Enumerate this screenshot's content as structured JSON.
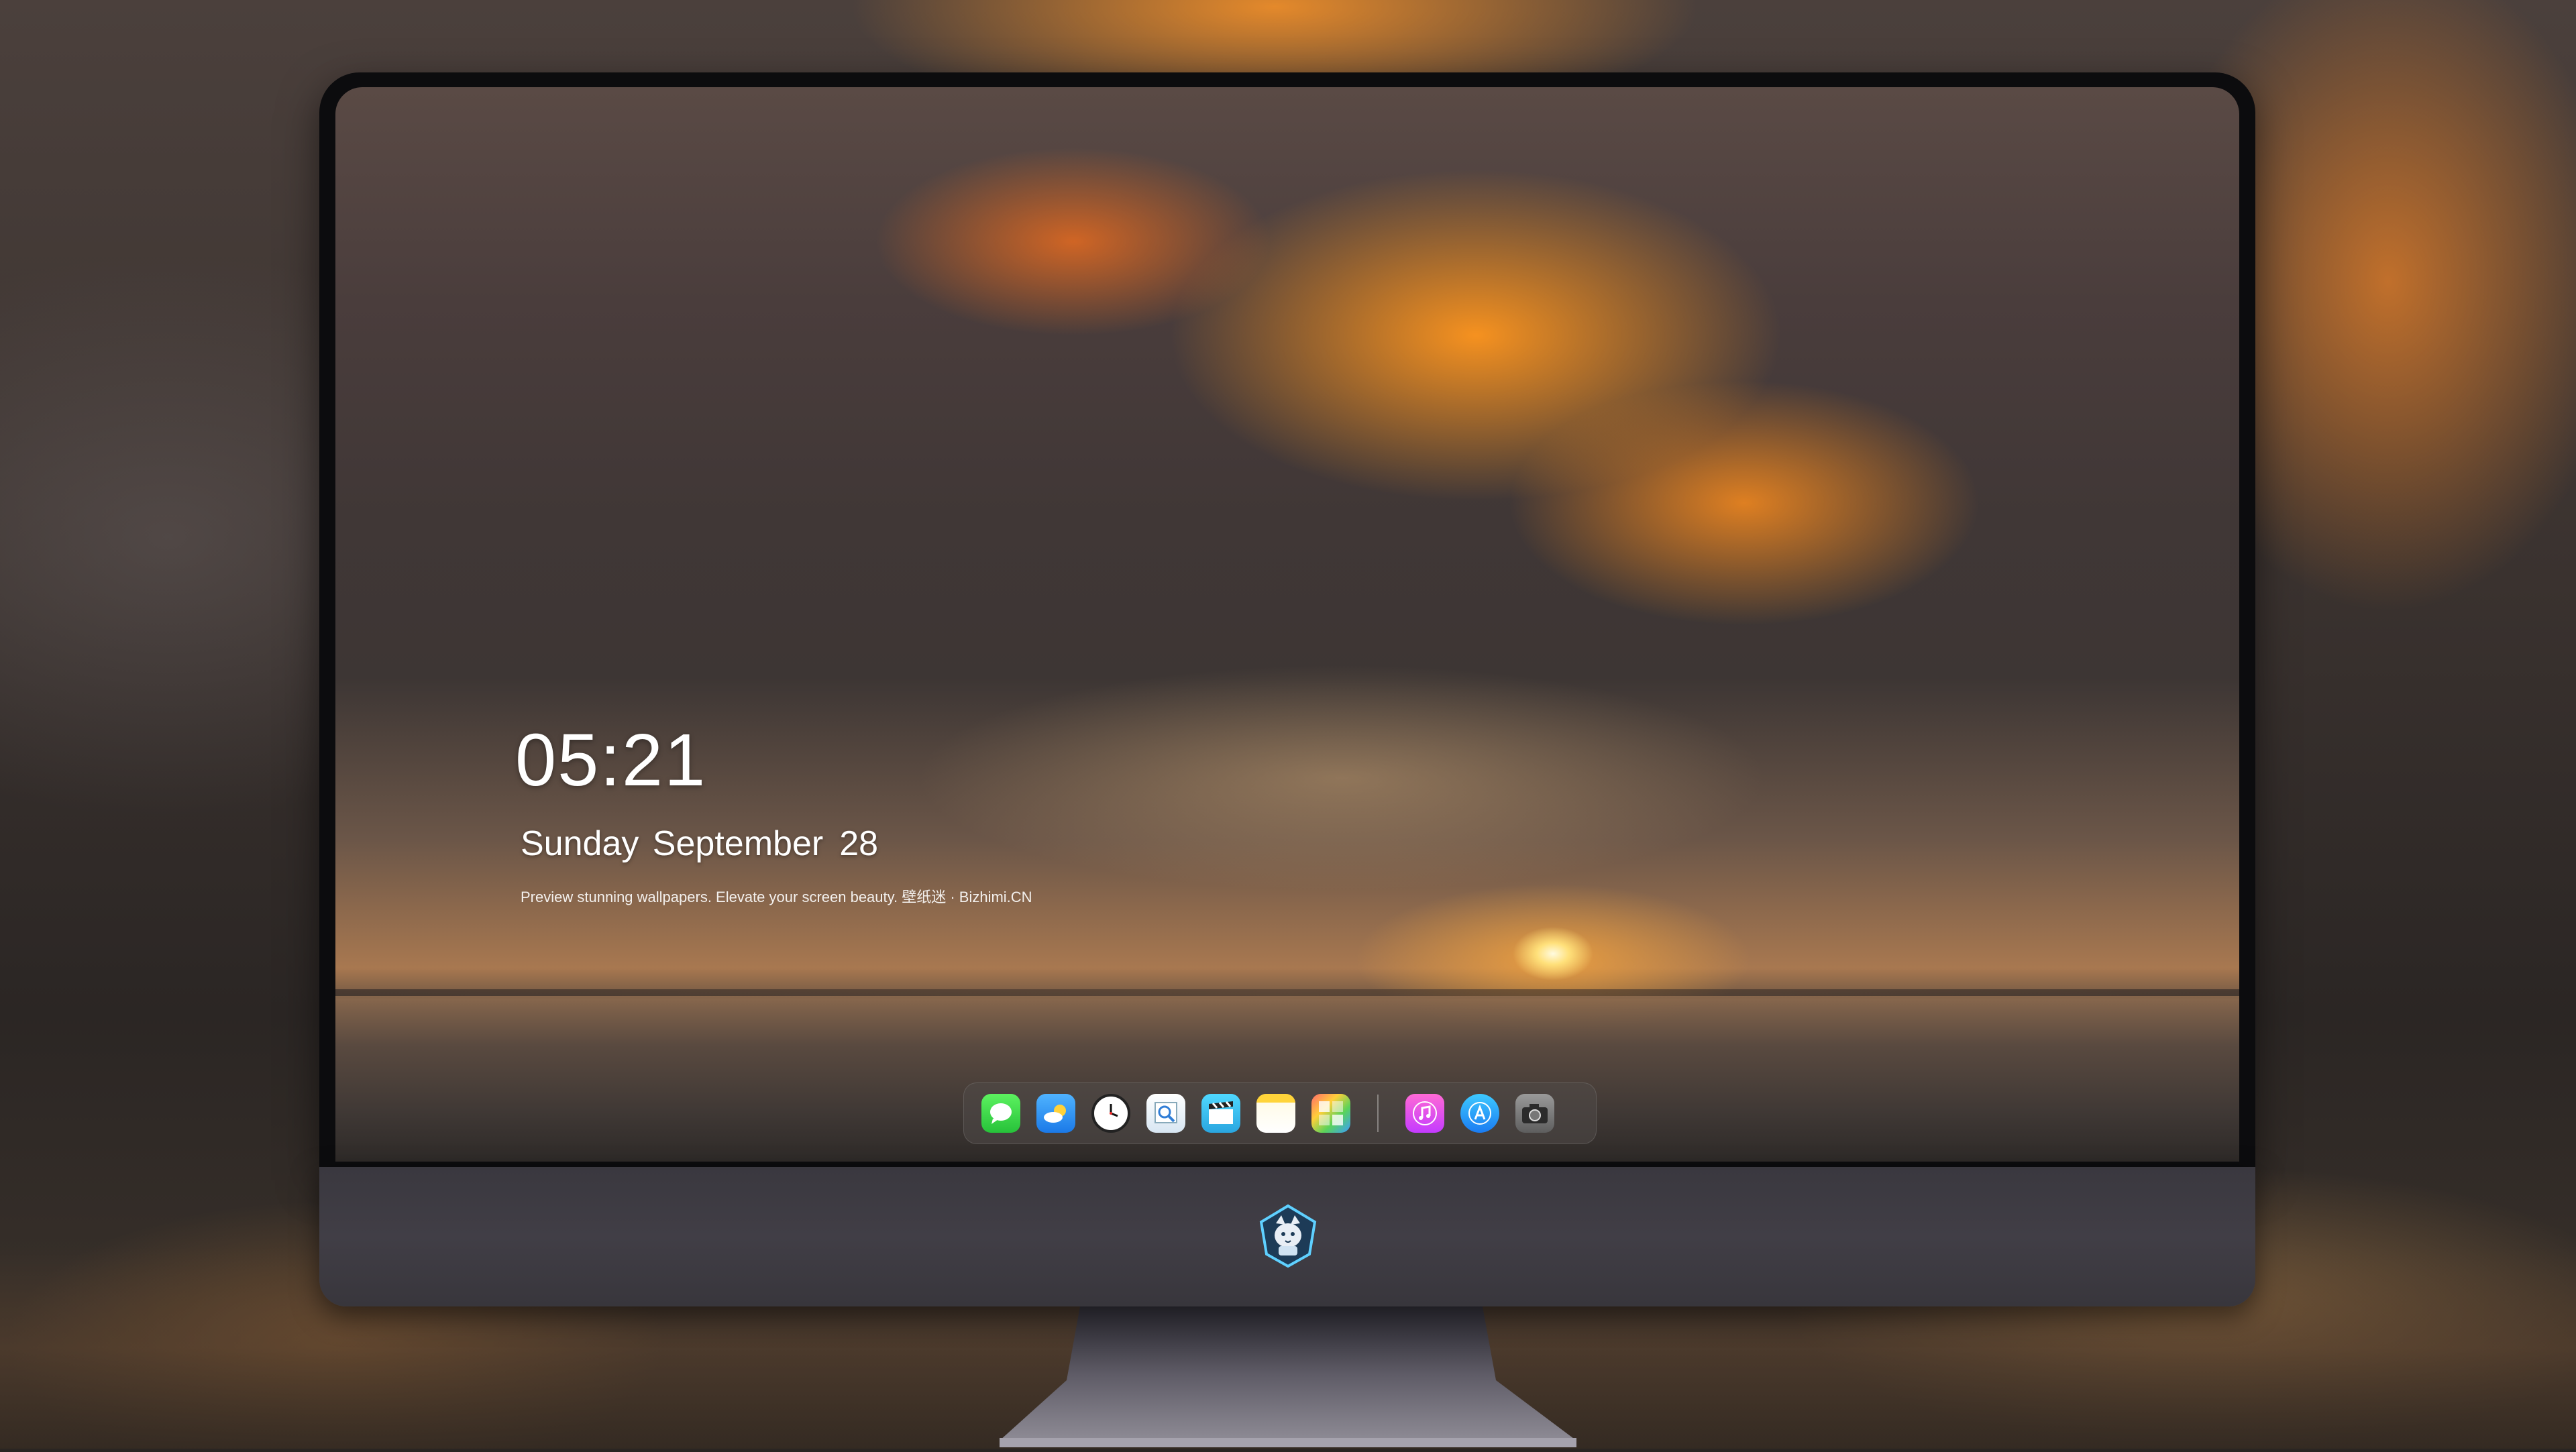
{
  "lockscreen": {
    "time": "05:21",
    "weekday_month": "Sunday September",
    "day": "28",
    "tagline": "Preview stunning wallpapers. Elevate your screen beauty. 壁纸迷 · Bizhimi.CN"
  },
  "dock": {
    "apps": [
      {
        "name": "messages-icon",
        "glyph": "💬"
      },
      {
        "name": "weather-icon",
        "glyph": "☁"
      },
      {
        "name": "clock-icon",
        "glyph": "🕓"
      },
      {
        "name": "preview-icon",
        "glyph": "🔍"
      },
      {
        "name": "clips-icon",
        "glyph": "🎬"
      },
      {
        "name": "notes-icon",
        "glyph": ""
      },
      {
        "name": "collage-icon",
        "glyph": "▦"
      }
    ],
    "apps_right": [
      {
        "name": "music-icon",
        "glyph": "♫"
      },
      {
        "name": "app-store-icon",
        "glyph": "Ⓐ"
      },
      {
        "name": "camera-icon",
        "glyph": "📷"
      }
    ]
  },
  "colors": {
    "sky_orange": "#f28a22",
    "chin": "#3d3a42",
    "bezel": "#0c0c0e"
  },
  "chin_logo": "cat-mascot-logo"
}
